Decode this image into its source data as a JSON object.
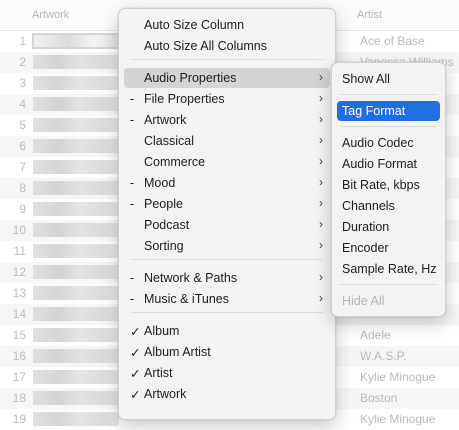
{
  "table": {
    "columns": [
      "Artwork",
      "Artist"
    ],
    "rows": [
      {
        "num": "1",
        "artist": "Ace of Base"
      },
      {
        "num": "2",
        "artist": "Vanessa Williams"
      },
      {
        "num": "3",
        "artist": ""
      },
      {
        "num": "4",
        "artist": ""
      },
      {
        "num": "5",
        "artist": ""
      },
      {
        "num": "6",
        "artist": ""
      },
      {
        "num": "7",
        "artist": ""
      },
      {
        "num": "8",
        "artist": ""
      },
      {
        "num": "9",
        "artist": ""
      },
      {
        "num": "10",
        "artist": ""
      },
      {
        "num": "11",
        "artist": ""
      },
      {
        "num": "12",
        "artist": ""
      },
      {
        "num": "13",
        "artist": ""
      },
      {
        "num": "14",
        "artist": ""
      },
      {
        "num": "15",
        "artist": "Adele"
      },
      {
        "num": "16",
        "artist": "W.A.S.P."
      },
      {
        "num": "17",
        "artist": "Kylie Minogue"
      },
      {
        "num": "18",
        "artist": "Boston"
      },
      {
        "num": "19",
        "artist": "Kylie Minogue"
      }
    ]
  },
  "main_menu": {
    "items": [
      {
        "label": "Auto Size Column",
        "prefix": "",
        "arrow": false
      },
      {
        "label": "Auto Size All Columns",
        "prefix": "",
        "arrow": false
      },
      {
        "label": "Audio Properties",
        "prefix": "",
        "arrow": true,
        "highlighted": true
      },
      {
        "label": "File Properties",
        "prefix": "-",
        "arrow": true
      },
      {
        "label": "Artwork",
        "prefix": "-",
        "arrow": true
      },
      {
        "label": "Classical",
        "prefix": "",
        "arrow": true
      },
      {
        "label": "Commerce",
        "prefix": "",
        "arrow": true
      },
      {
        "label": "Mood",
        "prefix": "-",
        "arrow": true
      },
      {
        "label": "People",
        "prefix": "-",
        "arrow": true
      },
      {
        "label": "Podcast",
        "prefix": "",
        "arrow": true
      },
      {
        "label": "Sorting",
        "prefix": "",
        "arrow": true
      },
      {
        "label": "Network & Paths",
        "prefix": "-",
        "arrow": true
      },
      {
        "label": "Music & iTunes",
        "prefix": "-",
        "arrow": true
      },
      {
        "label": "Album",
        "prefix": "✓",
        "arrow": false
      },
      {
        "label": "Album Artist",
        "prefix": "✓",
        "arrow": false
      },
      {
        "label": "Artist",
        "prefix": "✓",
        "arrow": false
      },
      {
        "label": "Artwork",
        "prefix": "✓",
        "arrow": false
      }
    ],
    "arrow_glyph": "›"
  },
  "sub_menu": {
    "items": [
      {
        "label": "Show All"
      },
      {
        "label": "Tag Format",
        "active": true
      },
      {
        "label": "Audio Codec"
      },
      {
        "label": "Audio Format"
      },
      {
        "label": "Bit Rate, kbps"
      },
      {
        "label": "Channels"
      },
      {
        "label": "Duration"
      },
      {
        "label": "Encoder"
      },
      {
        "label": "Sample Rate, Hz"
      },
      {
        "label": "Hide All",
        "disabled": true
      }
    ]
  }
}
